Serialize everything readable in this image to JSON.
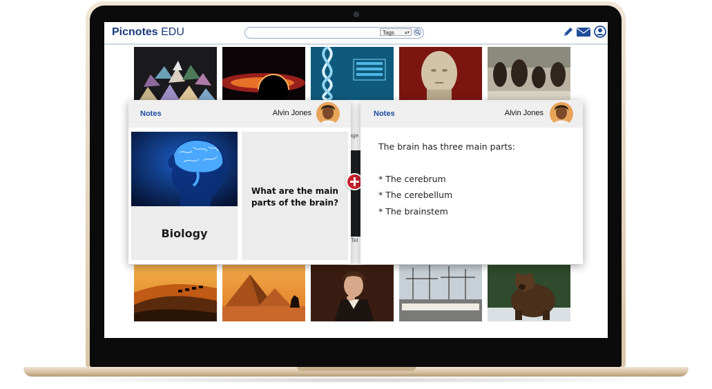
{
  "app": {
    "brand_bold": "Picnotes",
    "brand_rest": " EDU"
  },
  "search": {
    "value": "",
    "tags_selected": "Tags"
  },
  "header_icons": [
    "pencil-icon",
    "mail-icon",
    "user-icon"
  ],
  "card_left": {
    "label": "Notes",
    "author": "Alvin Jones",
    "subject": "Biology",
    "question": "What are the main parts of the brain?"
  },
  "card_right": {
    "label": "Notes",
    "author": "Alvin Jones",
    "answer_intro": "The brain has three main parts:",
    "answer_items": [
      "* The cerebrum",
      "* The cerebellum",
      "* The brainstem"
    ]
  },
  "fragments": {
    "left_caption": "rage",
    "mid_caption": "Tel"
  },
  "colors": {
    "brand": "#1b3a7a",
    "notes_label": "#1b4ba0",
    "add_button": "#c8202a"
  }
}
